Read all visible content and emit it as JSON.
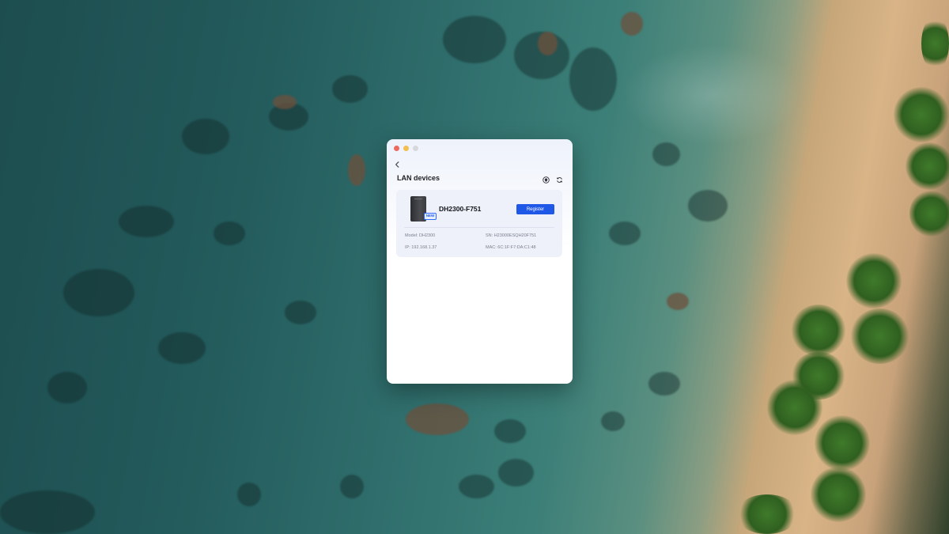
{
  "window": {
    "title": "LAN devices",
    "traffic_lights": [
      "close",
      "minimize",
      "zoom"
    ],
    "icons": {
      "back": "chevron-left-icon",
      "help": "info-shield-icon",
      "refresh": "refresh-icon"
    }
  },
  "device": {
    "name": "DH2300-F751",
    "badge": "NEW",
    "register_label": "Register",
    "model": "Model: DH2300",
    "sn": "SN: H23000ESQH20F751",
    "ip": "IP: 192.168.1.37",
    "mac": "MAC: 6C:1F:F7:DA:C1:48"
  },
  "colors": {
    "accent": "#1f57e7",
    "close": "#ec6a5e",
    "minimize": "#f4bf4f",
    "zoom_inactive": "#d6d8dc"
  }
}
